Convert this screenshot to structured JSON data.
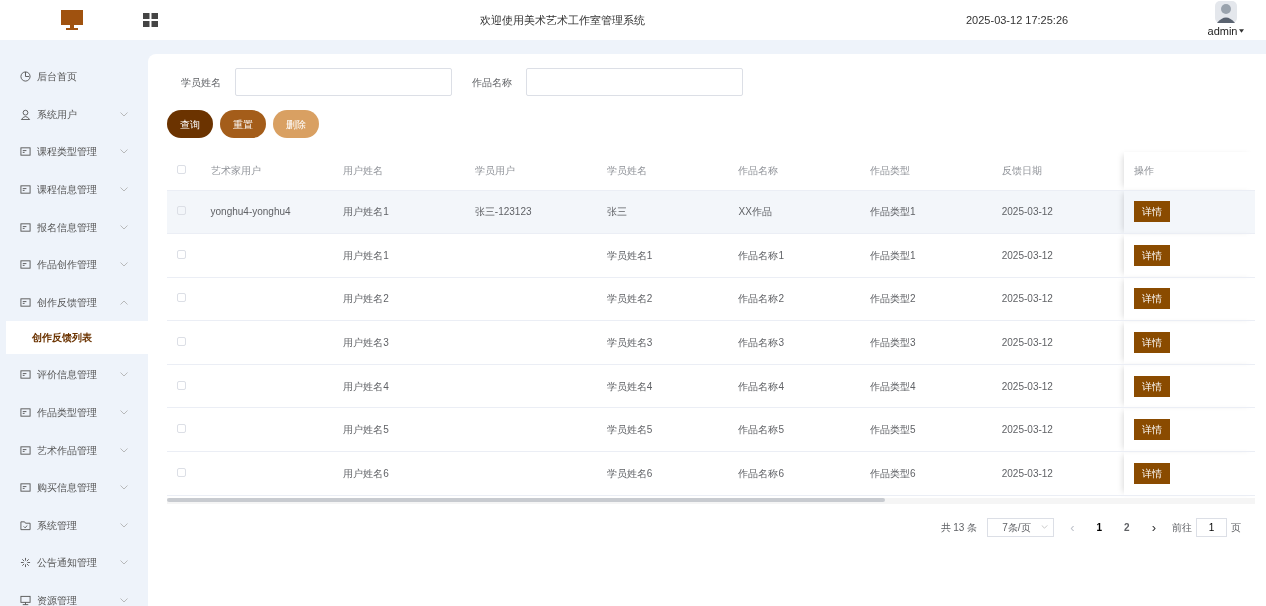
{
  "header": {
    "title": "欢迎使用美术艺术工作室管理系统",
    "datetime": "2025-03-12 17:25:26",
    "user": "admin"
  },
  "sidebar": {
    "items": [
      {
        "label": "后台首页",
        "kind": "link"
      },
      {
        "label": "系统用户",
        "kind": "menu",
        "expanded": false
      },
      {
        "label": "课程类型管理",
        "kind": "menu",
        "expanded": false
      },
      {
        "label": "课程信息管理",
        "kind": "menu",
        "expanded": false
      },
      {
        "label": "报名信息管理",
        "kind": "menu",
        "expanded": false
      },
      {
        "label": "作品创作管理",
        "kind": "menu",
        "expanded": false
      },
      {
        "label": "创作反馈管理",
        "kind": "menu",
        "expanded": true,
        "children": [
          {
            "label": "创作反馈列表",
            "selected": true
          }
        ]
      },
      {
        "label": "评价信息管理",
        "kind": "menu",
        "expanded": false
      },
      {
        "label": "作品类型管理",
        "kind": "menu",
        "expanded": false
      },
      {
        "label": "艺术作品管理",
        "kind": "menu",
        "expanded": false
      },
      {
        "label": "购买信息管理",
        "kind": "menu",
        "expanded": false
      },
      {
        "label": "系统管理",
        "kind": "menu",
        "expanded": false
      },
      {
        "label": "公告通知管理",
        "kind": "menu",
        "expanded": false
      },
      {
        "label": "资源管理",
        "kind": "menu",
        "expanded": false
      }
    ]
  },
  "search": {
    "fields": [
      {
        "label": "学员姓名"
      },
      {
        "label": "作品名称"
      }
    ],
    "buttons": [
      {
        "label": "查询",
        "kind": "search"
      },
      {
        "label": "重置",
        "kind": "reset"
      },
      {
        "label": "删除",
        "kind": "delete"
      }
    ]
  },
  "table": {
    "select_all_checked": false,
    "columns": [
      "艺术家用户",
      "用户姓名",
      "学员用户",
      "学员姓名",
      "作品名称",
      "作品类型",
      "反馈日期",
      "操作"
    ],
    "rows": [
      {
        "selected": true,
        "checked": false,
        "cells": [
          "yonghu4-yonghu4",
          "用户姓名1",
          "张三-123123",
          "张三",
          "XX作品",
          "作品类型1",
          "2025-03-12"
        ],
        "action": "详情"
      },
      {
        "selected": false,
        "checked": false,
        "cells": [
          "",
          "用户姓名1",
          "",
          "学员姓名1",
          "作品名称1",
          "作品类型1",
          "2025-03-12"
        ],
        "action": "详情"
      },
      {
        "selected": false,
        "checked": false,
        "cells": [
          "",
          "用户姓名2",
          "",
          "学员姓名2",
          "作品名称2",
          "作品类型2",
          "2025-03-12"
        ],
        "action": "详情"
      },
      {
        "selected": false,
        "checked": false,
        "cells": [
          "",
          "用户姓名3",
          "",
          "学员姓名3",
          "作品名称3",
          "作品类型3",
          "2025-03-12"
        ],
        "action": "详情"
      },
      {
        "selected": false,
        "checked": false,
        "cells": [
          "",
          "用户姓名4",
          "",
          "学员姓名4",
          "作品名称4",
          "作品类型4",
          "2025-03-12"
        ],
        "action": "详情"
      },
      {
        "selected": false,
        "checked": false,
        "cells": [
          "",
          "用户姓名5",
          "",
          "学员姓名5",
          "作品名称5",
          "作品类型5",
          "2025-03-12"
        ],
        "action": "详情"
      },
      {
        "selected": false,
        "checked": false,
        "cells": [
          "",
          "用户姓名6",
          "",
          "学员姓名6",
          "作品名称6",
          "作品类型6",
          "2025-03-12"
        ],
        "action": "详情"
      }
    ]
  },
  "pagination": {
    "total": "共 13 条",
    "page_size": "7条/页",
    "prev": "‹",
    "pages": [
      {
        "label": "1",
        "selected": true
      },
      {
        "label": "2",
        "selected": false
      }
    ],
    "next": "›",
    "goto_label": "前往",
    "goto_value": "1",
    "goto_suffix": "页"
  }
}
